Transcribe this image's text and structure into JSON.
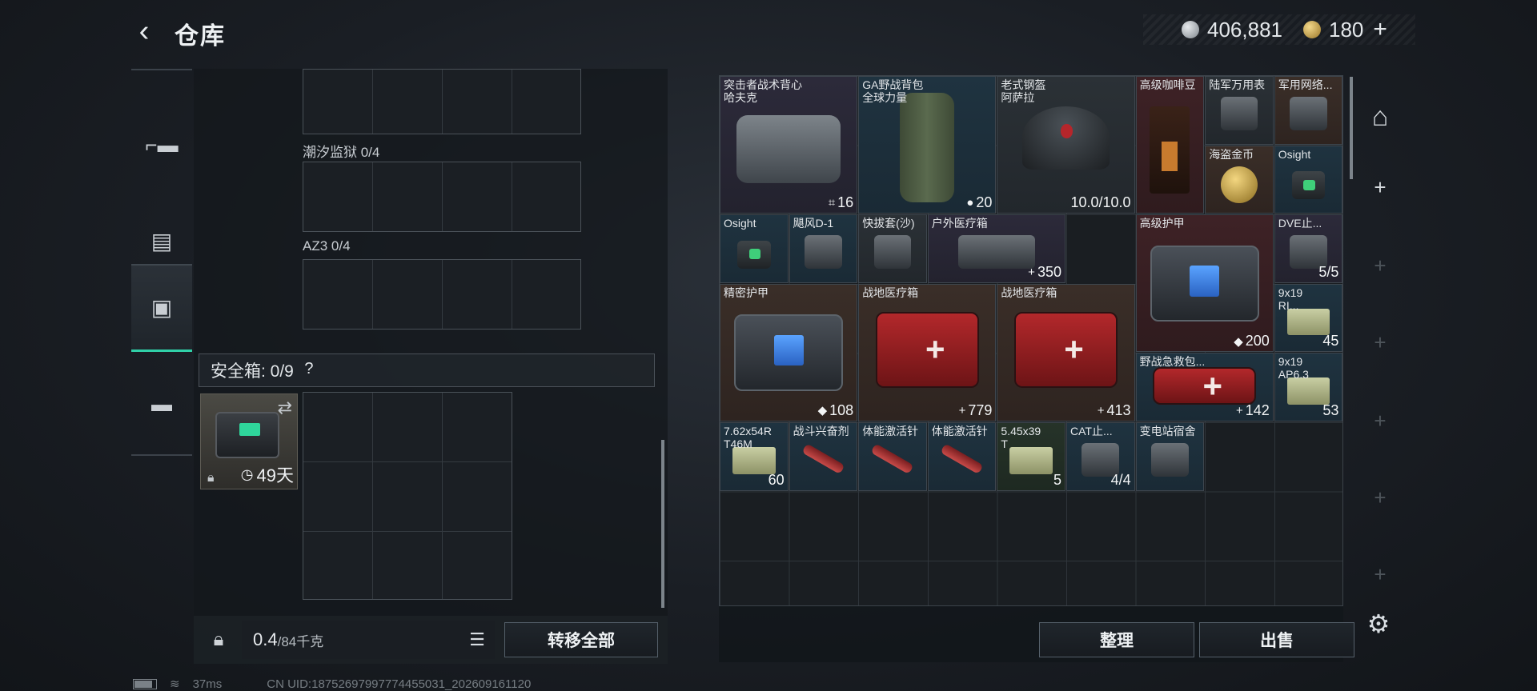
{
  "header": {
    "title": "仓库",
    "currency_silver": "406,881",
    "currency_gold": "180",
    "currency_plus": "+"
  },
  "tabs": [
    {
      "icon": "gun-icon",
      "glyph": "▰"
    },
    {
      "icon": "backpack-icon",
      "glyph": "◘"
    },
    {
      "icon": "container-icon",
      "glyph": "▣"
    },
    {
      "icon": "briefcase-icon",
      "glyph": "◼"
    }
  ],
  "left_panel": {
    "slot_1_label": "潮汐监狱 0/4",
    "slot_2_label": "AZ3 0/4",
    "safe_label": "安全箱: 0/9",
    "safe_help": "?",
    "safe_item_days": "49天",
    "weight_value": "0.4",
    "weight_max": "/84千克",
    "transfer_all": "转移全部"
  },
  "stash_items": [
    {
      "name": "突击者战术背心\n哈夫克",
      "value": "16",
      "value_icon": "⌗",
      "tint": "purple",
      "visual": "bag"
    },
    {
      "name": "GA野战背包\n全球力量",
      "value": "20",
      "value_icon": "●",
      "tint": "blue",
      "visual": "dufflebag"
    },
    {
      "name": "老式钢盔\n阿萨拉",
      "value": "10.0/10.0",
      "value_icon": "",
      "tint": "gray",
      "visual": "helmet"
    },
    {
      "name": "高级咖啡豆",
      "value": "",
      "tint": "red",
      "visual": "coffee"
    },
    {
      "name": "陆军万用表",
      "value": "",
      "tint": "gray",
      "visual": "generic"
    },
    {
      "name": "军用网络...",
      "value": "",
      "tint": "brown",
      "visual": "generic"
    },
    {
      "name": "海盗金币",
      "value": "",
      "tint": "brown",
      "visual": "coin-item"
    },
    {
      "name": "Osight",
      "value": "",
      "tint": "blue",
      "visual": "scope"
    },
    {
      "name": "Osight",
      "value": "",
      "tint": "blue",
      "visual": "scope"
    },
    {
      "name": "飓风D-1",
      "value": "",
      "tint": "blue",
      "visual": "generic"
    },
    {
      "name": "快拔套(沙)",
      "value": "",
      "tint": "gray",
      "visual": "generic"
    },
    {
      "name": "户外医疗箱",
      "value": "350",
      "value_icon": "+",
      "tint": "purple",
      "visual": "generic"
    },
    {
      "name": "高级护甲",
      "value": "200",
      "value_icon": "◆",
      "tint": "red",
      "visual": "armor"
    },
    {
      "name": "DVE止...",
      "value": "5/5",
      "value_icon": "",
      "tint": "purple",
      "visual": "generic"
    },
    {
      "name": "精密护甲",
      "value": "108",
      "value_icon": "◆",
      "tint": "brown",
      "visual": "armor"
    },
    {
      "name": "战地医疗箱",
      "value": "779",
      "value_icon": "+",
      "tint": "brown",
      "visual": "medkit"
    },
    {
      "name": "战地医疗箱",
      "value": "413",
      "value_icon": "+",
      "tint": "brown",
      "visual": "medkit"
    },
    {
      "name": "9x19\nRI...",
      "value": "45",
      "value_icon": "",
      "tint": "blue",
      "visual": "ammo-box"
    },
    {
      "name": "野战急救包...",
      "value": "142",
      "value_icon": "+",
      "tint": "blue",
      "visual": "medkit"
    },
    {
      "name": "9x19\nAP6.3",
      "value": "53",
      "value_icon": "",
      "tint": "blue",
      "visual": "ammo-box"
    },
    {
      "name": "7.62x54R\nT46M",
      "value": "60",
      "value_icon": "",
      "tint": "blue",
      "visual": "ammo-box"
    },
    {
      "name": "战斗兴奋剂",
      "value": "",
      "tint": "blue",
      "visual": "syringe"
    },
    {
      "name": "体能激活针",
      "value": "",
      "tint": "blue",
      "visual": "syringe"
    },
    {
      "name": "体能激活针",
      "value": "",
      "tint": "blue",
      "visual": "syringe"
    },
    {
      "name": "5.45x39\nT",
      "value": "5",
      "value_icon": "",
      "tint": "green",
      "visual": "ammo-box"
    },
    {
      "name": "CAT止...",
      "value": "4/4",
      "value_icon": "",
      "tint": "blue",
      "visual": "generic"
    },
    {
      "name": "变电站宿舍",
      "value": "",
      "tint": "blue",
      "visual": "generic"
    }
  ],
  "stash_buttons": {
    "sort": "整理",
    "sell": "出售"
  },
  "status_bar": {
    "ping": "37ms",
    "uid": "CN UID:18752697997774455031_202609161120"
  }
}
